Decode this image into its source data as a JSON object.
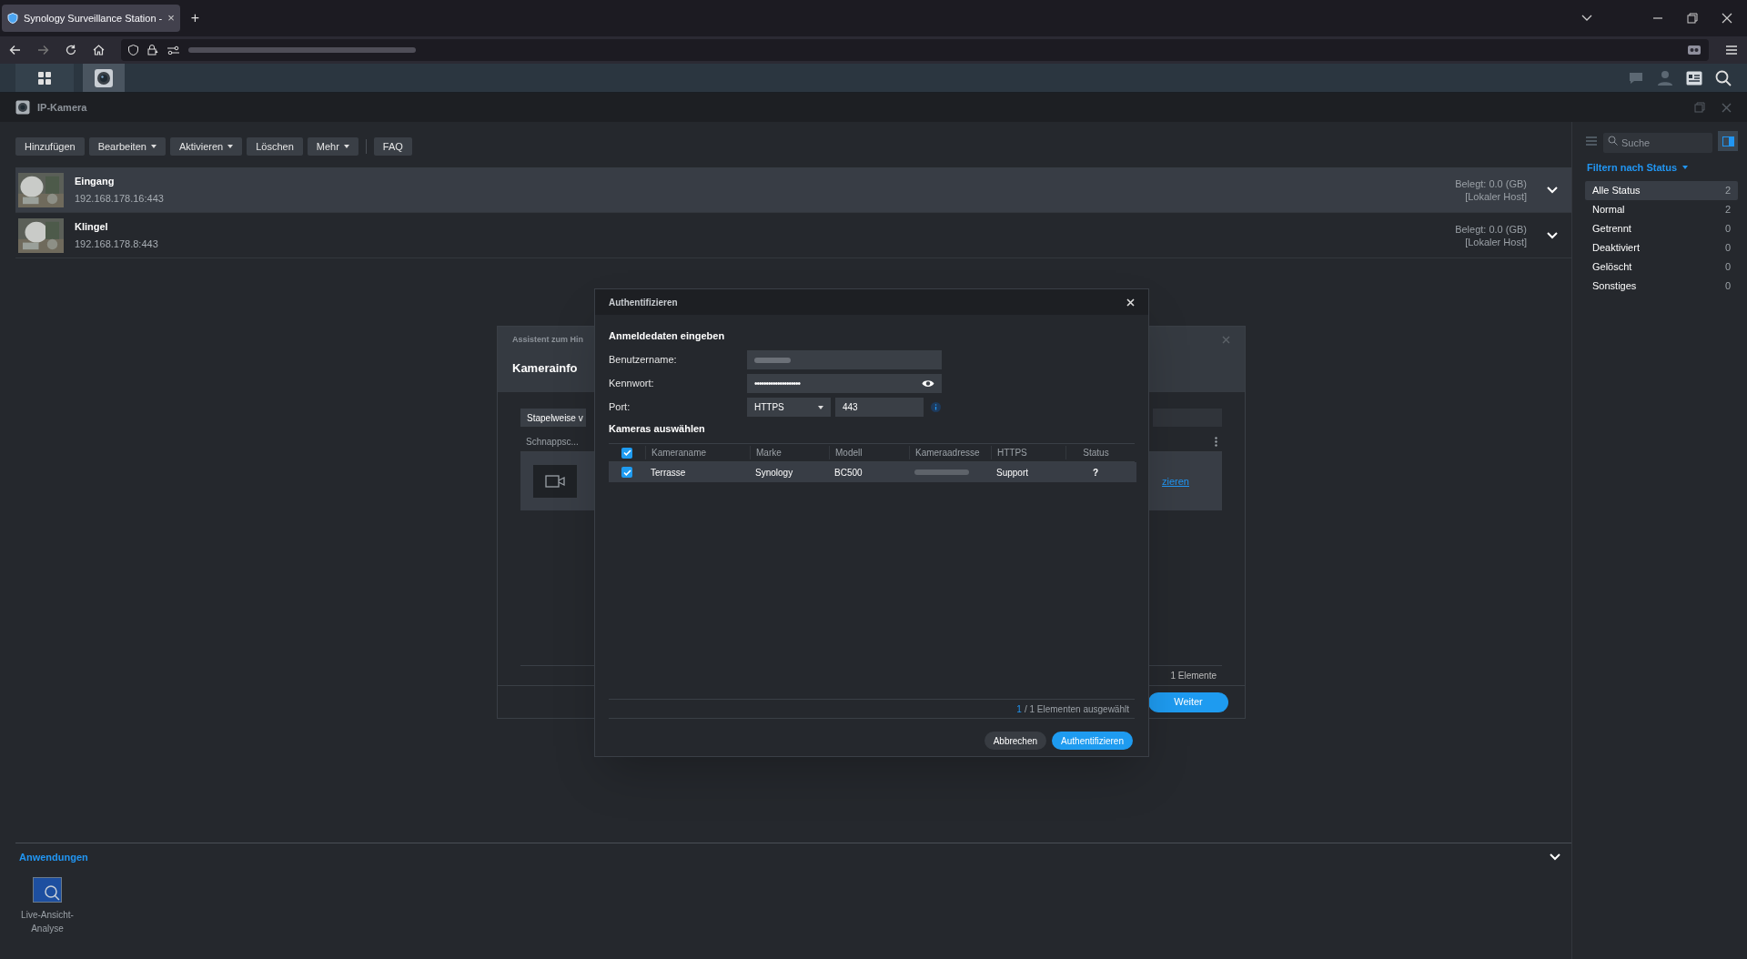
{
  "browser": {
    "tab_title": "Synology Surveillance Station -",
    "tab_close": "×",
    "new_tab": "+"
  },
  "app": {
    "window_title": "IP-Kamera"
  },
  "toolbar": [
    {
      "label": "Hinzufügen",
      "dropdown": false
    },
    {
      "label": "Bearbeiten",
      "dropdown": true
    },
    {
      "label": "Aktivieren",
      "dropdown": true
    },
    {
      "label": "Löschen",
      "dropdown": false
    },
    {
      "label": "Mehr",
      "dropdown": true
    },
    {
      "label": "FAQ",
      "dropdown": false
    }
  ],
  "cameras": [
    {
      "name": "Eingang",
      "address": "192.168.178.16:443",
      "usage": "Belegt: 0.0 (GB)",
      "host": "[Lokaler Host]",
      "selected": true
    },
    {
      "name": "Klingel",
      "address": "192.168.178.8:443",
      "usage": "Belegt: 0.0 (GB)",
      "host": "[Lokaler Host]",
      "selected": false
    }
  ],
  "sidebar": {
    "search_placeholder": "Suche",
    "filter_title": "Filtern nach Status",
    "filters": [
      {
        "label": "Alle Status",
        "count": "2",
        "selected": true
      },
      {
        "label": "Normal",
        "count": "2",
        "selected": false
      },
      {
        "label": "Getrennt",
        "count": "0",
        "selected": false
      },
      {
        "label": "Deaktiviert",
        "count": "0",
        "selected": false
      },
      {
        "label": "Gelöscht",
        "count": "0",
        "selected": false
      },
      {
        "label": "Sonstiges",
        "count": "0",
        "selected": false
      }
    ]
  },
  "wizard": {
    "title": "Assistent zum Hin",
    "heading": "Kamerainfo",
    "batch_button": "Stapelweise v",
    "column": "Schnappsc...",
    "link": "zieren",
    "count": "1 Elemente",
    "next_button": "Weiter"
  },
  "auth_dialog": {
    "title": "Authentifizieren",
    "credentials_heading": "Anmeldedaten eingeben",
    "username_label": "Benutzername:",
    "password_label": "Kennwort:",
    "password": "••••••••••••••••••••",
    "port_label": "Port:",
    "protocol": "HTTPS",
    "port": "443",
    "cameras_heading": "Kameras auswählen",
    "all_checked": true,
    "columns": [
      "Kameraname",
      "Marke",
      "Modell",
      "Kameraadresse",
      "HTTPS",
      "Status"
    ],
    "rows": [
      {
        "checked": true,
        "name": "Terrasse",
        "brand": "Synology",
        "model": "BC500",
        "https": "Support",
        "status": "?"
      }
    ],
    "selected_count": "1",
    "selection_text": "/ 1 Elementen ausgewählt",
    "cancel_button": "Abbrechen",
    "confirm_button": "Authentifizieren"
  },
  "applications": {
    "title": "Anwendungen",
    "items": [
      {
        "label": "Live-Ansicht-Analyse"
      }
    ]
  }
}
